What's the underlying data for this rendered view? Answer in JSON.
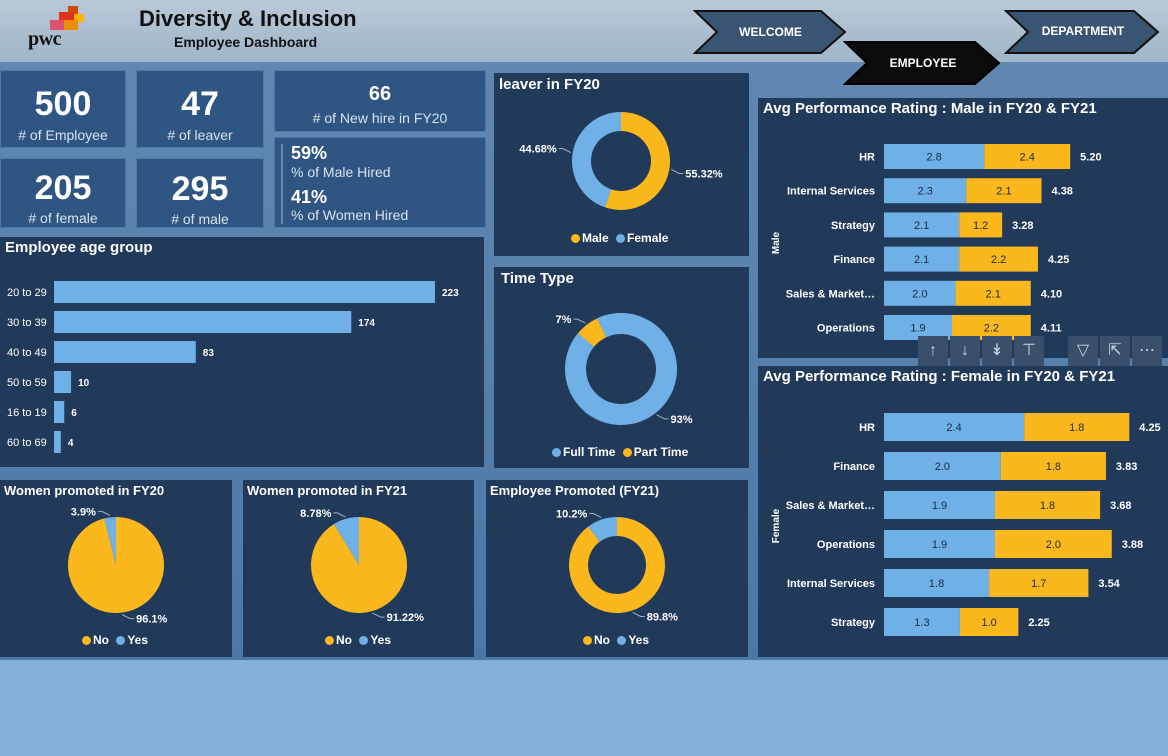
{
  "header": {
    "logo_text": "pwc",
    "title": "Diversity & Inclusion",
    "subtitle": "Employee Dashboard",
    "nav": [
      {
        "label": "WELCOME",
        "active": false
      },
      {
        "label": "EMPLOYEE",
        "active": true
      },
      {
        "label": "DEPARTMENT",
        "active": false
      }
    ]
  },
  "kpis": {
    "employees": {
      "value": "500",
      "label": "# of Employee"
    },
    "leavers": {
      "value": "47",
      "label": "# of leaver"
    },
    "new_hire": {
      "value": "66",
      "label": "# of New hire  in FY20"
    },
    "female": {
      "value": "205",
      "label": "# of female"
    },
    "male": {
      "value": "295",
      "label": "# of male"
    },
    "male_hired": {
      "value": "59%",
      "label": "% of Male Hired"
    },
    "women_hired": {
      "value": "41%",
      "label": "% of Women Hired"
    }
  },
  "colors": {
    "male": "#6fb0e6",
    "female": "#fbb81c",
    "blue": "#6fb0e6",
    "yellow": "#fbb81c",
    "panel": "#213a59"
  },
  "toolbar": {
    "icons": [
      "arrow-up-icon",
      "arrow-down-icon",
      "expand-all-icon",
      "drill-icon",
      "filter-icon",
      "focus-mode-icon",
      "more-options-icon"
    ]
  },
  "chart_data": [
    {
      "id": "leaver",
      "type": "donut",
      "title": "leaver in FY20",
      "categories": [
        "Male",
        "Female"
      ],
      "values": [
        55.32,
        44.68
      ],
      "value_labels": [
        "55.32%",
        "44.68%"
      ],
      "legend": [
        "Male",
        "Female"
      ]
    },
    {
      "id": "time_type",
      "type": "donut",
      "title": "Time Type",
      "categories": [
        "Full Time",
        "Part Time"
      ],
      "values": [
        93,
        7
      ],
      "value_labels": [
        "93%",
        "7%"
      ],
      "legend": [
        "Full Time",
        "Part Time"
      ]
    },
    {
      "id": "age",
      "type": "bar",
      "orientation": "horizontal",
      "title": "Employee age group",
      "categories": [
        "20 to 29",
        "30 to 39",
        "40 to 49",
        "50 to 59",
        "16 to 19",
        "60 to 69"
      ],
      "values": [
        223,
        174,
        83,
        10,
        6,
        4
      ],
      "value_labels": [
        "223",
        "174",
        "83",
        "10",
        "6",
        "4"
      ]
    },
    {
      "id": "women_fy20",
      "type": "pie",
      "title": "Women promoted in FY20",
      "categories": [
        "No",
        "Yes"
      ],
      "values": [
        96.1,
        3.9
      ],
      "value_labels": [
        "96.1%",
        "3.9%"
      ],
      "legend": [
        "No",
        "Yes"
      ]
    },
    {
      "id": "women_fy21",
      "type": "pie",
      "title": "Women promoted in FY21",
      "categories": [
        "No",
        "Yes"
      ],
      "values": [
        91.22,
        8.78
      ],
      "value_labels": [
        "91.22%",
        "8.78%"
      ],
      "legend": [
        "No",
        "Yes"
      ]
    },
    {
      "id": "emp_promoted",
      "type": "donut",
      "title": "Employee Promoted (FY21)",
      "categories": [
        "No",
        "Yes"
      ],
      "values": [
        89.8,
        10.2
      ],
      "value_labels": [
        "89.8%",
        "10.2%"
      ],
      "legend": [
        "No",
        "Yes"
      ]
    },
    {
      "id": "perf_male",
      "type": "bar",
      "orientation": "horizontal",
      "stacked": true,
      "title": "Avg Performance Rating : Male in FY20 & FY21",
      "ylabel": "Male",
      "categories": [
        "HR",
        "Internal Services",
        "Strategy",
        "Finance",
        "Sales & Market…",
        "Operations"
      ],
      "series": [
        {
          "values": [
            2.8,
            2.3,
            2.1,
            2.1,
            2.0,
            1.9
          ],
          "value_labels": [
            "2.8",
            "2.3",
            "2.1",
            "2.1",
            "2.0",
            "1.9"
          ]
        },
        {
          "values": [
            2.4,
            2.1,
            1.2,
            2.2,
            2.1,
            2.2
          ],
          "value_labels": [
            "2.4",
            "2.1",
            "1.2",
            "2.2",
            "2.1",
            "2.2"
          ]
        }
      ],
      "totals": [
        "5.20",
        "4.38",
        "3.28",
        "4.25",
        "4.10",
        "4.11"
      ]
    },
    {
      "id": "perf_female",
      "type": "bar",
      "orientation": "horizontal",
      "stacked": true,
      "title": "Avg Performance Rating : Female in FY20 & FY21",
      "ylabel": "Female",
      "categories": [
        "HR",
        "Finance",
        "Sales & Market…",
        "Operations",
        "Internal Services",
        "Strategy"
      ],
      "series": [
        {
          "values": [
            2.4,
            2.0,
            1.9,
            1.9,
            1.8,
            1.3
          ],
          "value_labels": [
            "2.4",
            "2.0",
            "1.9",
            "1.9",
            "1.8",
            "1.3"
          ]
        },
        {
          "values": [
            1.8,
            1.8,
            1.8,
            2.0,
            1.7,
            1.0
          ],
          "value_labels": [
            "1.8",
            "1.8",
            "1.8",
            "2.0",
            "1.7",
            "1.0"
          ]
        }
      ],
      "totals": [
        "4.25",
        "3.83",
        "3.68",
        "3.88",
        "3.54",
        "2.25"
      ]
    }
  ]
}
